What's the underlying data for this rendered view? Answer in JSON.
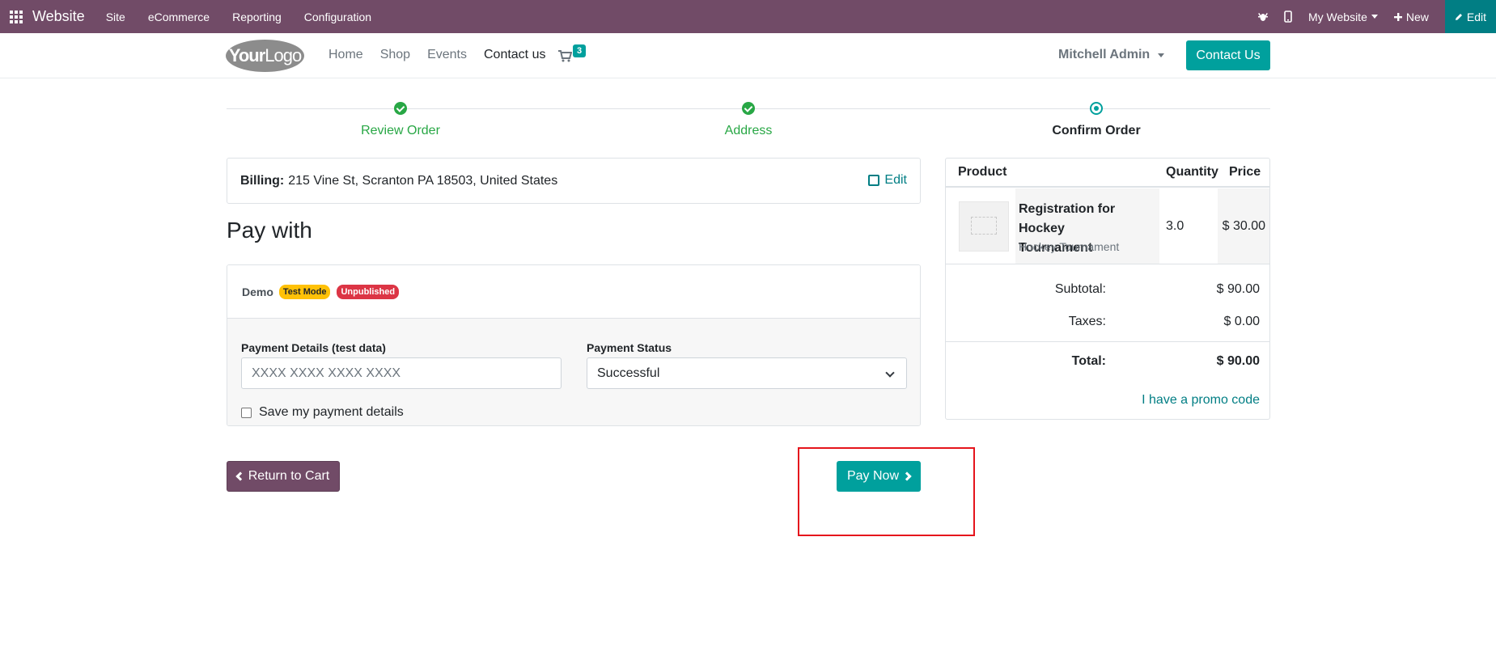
{
  "admin_bar": {
    "brand": "Website",
    "menu": [
      "Site",
      "eCommerce",
      "Reporting",
      "Configuration"
    ],
    "website_selector": "My Website",
    "new_label": "New",
    "edit_label": "Edit"
  },
  "header": {
    "logo_text_bold": "Your",
    "logo_text_rest": "Logo",
    "nav": [
      "Home",
      "Shop",
      "Events",
      "Contact us"
    ],
    "cart_count": "3",
    "user": "Mitchell Admin",
    "contact_button": "Contact Us"
  },
  "steps": [
    {
      "label": "Review Order",
      "state": "done"
    },
    {
      "label": "Address",
      "state": "done"
    },
    {
      "label": "Confirm Order",
      "state": "current"
    }
  ],
  "billing": {
    "label": "Billing:",
    "address": "215 Vine St, Scranton PA 18503, United States",
    "edit_label": "Edit"
  },
  "pay_with": {
    "title": "Pay with",
    "provider": "Demo",
    "badge_test": "Test Mode",
    "badge_unpublished": "Unpublished",
    "details_label": "Payment Details (test data)",
    "details_placeholder": "XXXX XXXX XXXX XXXX",
    "status_label": "Payment Status",
    "status_value": "Successful",
    "save_label": "Save my payment details"
  },
  "actions": {
    "return_label": "Return to Cart",
    "pay_label": "Pay Now"
  },
  "summary": {
    "headers": {
      "product": "Product",
      "quantity": "Quantity",
      "price": "Price"
    },
    "item": {
      "name": "Registration for Hockey Tournament",
      "subtitle": "Hockey Tournament",
      "quantity": "3.0",
      "price": "$ 30.00"
    },
    "subtotal_label": "Subtotal:",
    "subtotal_value": "$ 90.00",
    "taxes_label": "Taxes:",
    "taxes_value": "$ 0.00",
    "total_label": "Total:",
    "total_value": "$ 90.00",
    "promo_label": "I have a promo code"
  },
  "colors": {
    "admin_bar": "#714b67",
    "primary": "#00a09d",
    "success": "#28a745",
    "highlight": "#e5141c"
  }
}
